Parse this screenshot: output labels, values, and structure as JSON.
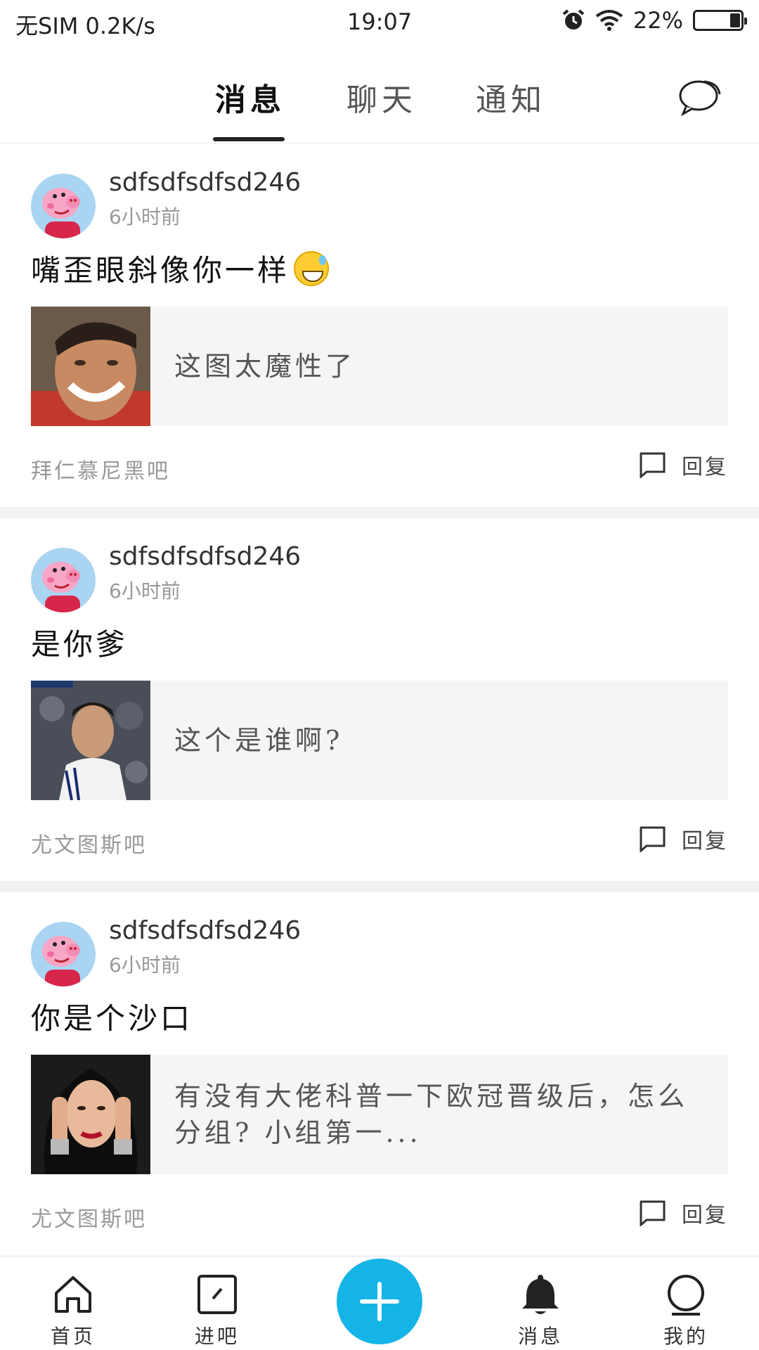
{
  "status_bar": {
    "carrier": "无SIM 0.2K/s",
    "time": "19:07",
    "battery": "22%",
    "battery_level": 0.22
  },
  "top_tabs": [
    {
      "label": "消息",
      "active": true
    },
    {
      "label": "聊天",
      "active": false
    },
    {
      "label": "通知",
      "active": false
    }
  ],
  "posts": [
    {
      "username": "sdfsdfsdfsd246",
      "time_ago": "6小时前",
      "title": "嘴歪眼斜像你一样",
      "has_emoji": true,
      "quote": "这图太魔性了",
      "forum": "拜仁慕尼黑吧",
      "reply_label": "回复"
    },
    {
      "username": "sdfsdfsdfsd246",
      "time_ago": "6小时前",
      "title": "是你爹",
      "has_emoji": false,
      "quote": "这个是谁啊?",
      "forum": "尤文图斯吧",
      "reply_label": "回复"
    },
    {
      "username": "sdfsdfsdfsd246",
      "time_ago": "6小时前",
      "title": "你是个沙口",
      "has_emoji": false,
      "quote": "有没有大佬科普一下欧冠晋级后，怎么分组? 小组第一...",
      "forum": "尤文图斯吧",
      "reply_label": "回复"
    }
  ],
  "bottom_nav": {
    "home": "首页",
    "bars": "进吧",
    "messages": "消息",
    "profile": "我的"
  },
  "colors": {
    "accent": "#14b4e6",
    "quote_bg": "#f5f5f5",
    "separator": "#f2f2f2"
  }
}
